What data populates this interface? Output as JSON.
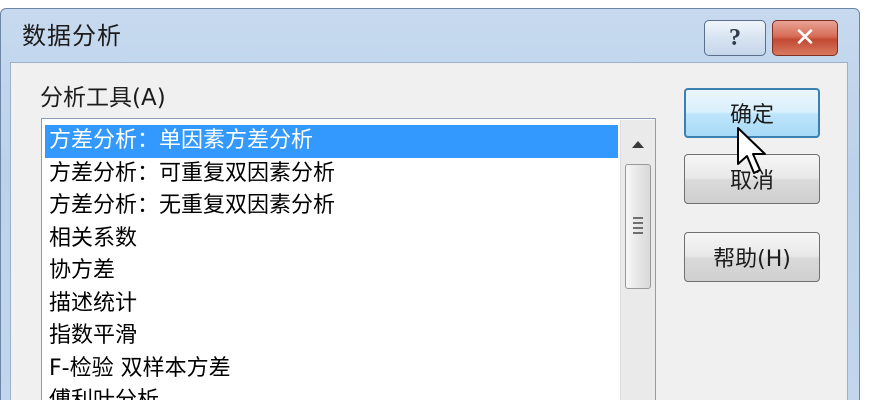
{
  "window": {
    "title": "数据分析"
  },
  "caption_buttons": {
    "help_glyph": "?",
    "close_glyph": "✕"
  },
  "analysis_tools": {
    "label": "分析工具(A)",
    "selected_index": 0,
    "items": [
      "方差分析：单因素方差分析",
      "方差分析：可重复双因素分析",
      "方差分析：无重复双因素分析",
      "相关系数",
      "协方差",
      "描述统计",
      "指数平滑",
      "F-检验 双样本方差",
      "傅利叶分析"
    ]
  },
  "buttons": {
    "ok": "确定",
    "cancel": "取消",
    "help": "帮助(H)"
  },
  "colors": {
    "selection": "#3399ff",
    "default_button_border": "#3c7fb1",
    "close_button": "#c24a33"
  }
}
